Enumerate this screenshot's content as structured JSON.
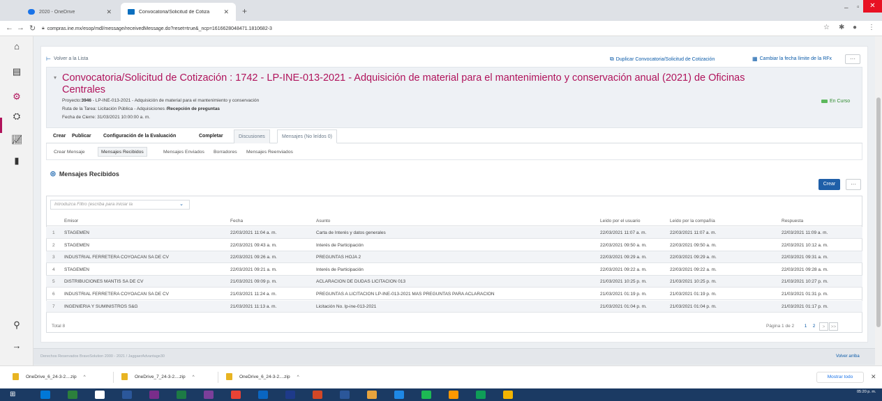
{
  "browser": {
    "tabs": [
      {
        "title": "2020 - OneDrive",
        "active": false
      },
      {
        "title": "Convocatoria/Solicitud de Cotiza",
        "active": true
      }
    ],
    "new_tab": "+",
    "url": "compras.ine.mx/esop/mdl/message/receivedMessage.do?reset=true&_ncp=1616628048471.1810682-3"
  },
  "topbar": {
    "back_label": "Volver a la Lista",
    "duplicate_label": "Duplicar Convocatoria/Solicitud de Cotización",
    "change_date_label": "Cambiar la fecha límite de la RFx",
    "more": "···"
  },
  "header": {
    "title": "Convocatoria/Solicitud de Cotización : 1742 - LP-INE-013-2021 - Adquisición de material para el mantenimiento y conservación anual (2021) de Oficinas Centrales",
    "project_label": "Proyecto:",
    "project_code": "3946",
    "project_rest": "- LP-INE-013-2021 - Adquisición de material para el mantenimiento y conservación",
    "route_label": "Ruta de la Tarea: Licitación Pública - Adquisiciones /",
    "route_bold": "Recepción de preguntas",
    "close_date": "Fecha de Cierre: 31/03/2021 10:00:00 a. m.",
    "status": "En Curso"
  },
  "tabs": [
    {
      "label": "Crear"
    },
    {
      "label": "Publicar"
    },
    {
      "label": "Configuración de la Evaluación"
    },
    {
      "label": "Completar"
    },
    {
      "label": "Discusiones"
    },
    {
      "label": "Mensajes (No leídos 0)"
    }
  ],
  "subtabs": [
    {
      "label": "Crear Mensaje"
    },
    {
      "label": "Mensajes Recibidos"
    },
    {
      "label": "Mensajes Enviados"
    },
    {
      "label": "Borradores"
    },
    {
      "label": "Mensajes Reenviados"
    }
  ],
  "section_title": "Mensajes Recibidos",
  "create_button": "Crear",
  "more_button": "···",
  "filter_placeholder": "Introduzca Filtro (escriba para iniciar la",
  "table": {
    "columns": [
      "Emisor",
      "Fecha",
      "Asunto",
      "Leído por el usuario",
      "Leído por la compañía",
      "Respuesta"
    ],
    "rows": [
      {
        "n": "1",
        "emisor": "STAGEMEN",
        "fecha": "22/03/2021 11:04 a. m.",
        "asunto": "Carta de Interés y datos generales",
        "usuario": "22/03/2021 11:07 a. m.",
        "compania": "22/03/2021 11:07 a. m.",
        "respuesta": "22/03/2021 11:09 a. m."
      },
      {
        "n": "2",
        "emisor": "STAGEMEN",
        "fecha": "22/03/2021 09:43 a. m.",
        "asunto": "Interés de Participación",
        "usuario": "22/03/2021 09:50 a. m.",
        "compania": "22/03/2021 09:50 a. m.",
        "respuesta": "22/03/2021 10:12 a. m."
      },
      {
        "n": "3",
        "emisor": "INDUSTRIAL FERRETERA COYOACAN SA DE CV",
        "fecha": "22/03/2021 09:26 a. m.",
        "asunto": "PREGUNTAS HOJA 2",
        "usuario": "22/03/2021 09:29 a. m.",
        "compania": "22/03/2021 09:29 a. m.",
        "respuesta": "22/03/2021 09:31 a. m."
      },
      {
        "n": "4",
        "emisor": "STAGEMEN",
        "fecha": "22/03/2021 09:21 a. m.",
        "asunto": "Interés de Participación",
        "usuario": "22/03/2021 09:22 a. m.",
        "compania": "22/03/2021 09:22 a. m.",
        "respuesta": "22/03/2021 09:28 a. m."
      },
      {
        "n": "5",
        "emisor": "DISTRIBUCIONES MANTIS SA DE CV",
        "fecha": "21/03/2021 09:09 p. m.",
        "asunto": "ACLARACION DE DUDAS LICITACION 013",
        "usuario": "21/03/2021 10:25 p. m.",
        "compania": "21/03/2021 10:25 p. m.",
        "respuesta": "21/03/2021 10:27 p. m."
      },
      {
        "n": "6",
        "emisor": "INDUSTRIAL FERRETERA COYOACAN SA DE CV",
        "fecha": "21/03/2021 11:24 a. m.",
        "asunto": "PREGUNTAS A LICITACION LP-INE-013-2021 MAS PREGUNTAS PARA ACLARACION",
        "usuario": "21/03/2021 01:19 p. m.",
        "compania": "21/03/2021 01:19 p. m.",
        "respuesta": "21/03/2021 01:31 p. m."
      },
      {
        "n": "7",
        "emisor": "INGENIERIA Y SUMINISTROS S&G",
        "fecha": "21/03/2021 11:13 a. m.",
        "asunto": "Licitación No. lp-ine-013-2021",
        "usuario": "21/03/2021 01:04 p. m.",
        "compania": "21/03/2021 01:04 p. m.",
        "respuesta": "21/03/2021 01:17 p. m."
      }
    ],
    "total": "Total 8",
    "page_info": "Página 1 de 2",
    "pages": [
      "1",
      "2"
    ],
    "next": ">",
    "last": ">>"
  },
  "footer": {
    "copyright": "Derechos Reservados BravoSolution 2000 - 2021 / JaggaerAdvantage30",
    "back_to_top": "Volver arriba"
  },
  "downloads": {
    "items": [
      "OneDrive_6_24-3-2....zip",
      "OneDrive_7_24-3-2....zip",
      "OneDrive_6_24-3-2....zip"
    ],
    "show_all": "Mostrar todo"
  },
  "taskbar": {
    "time": "05:20 p. m.",
    "apps": [
      "#0078d7",
      "#2c7f3c",
      "#ffffff",
      "#2b579a",
      "#7a2d8a",
      "#1d7a45",
      "#7b3f9a",
      "#ea4335",
      "#0a66c2",
      "#1e3a8a",
      "#d24726",
      "#2b579a",
      "#e8a33d",
      "#1e88e5",
      "#1db954",
      "#ff9800",
      "#0f9d58",
      "#f4b400"
    ]
  }
}
